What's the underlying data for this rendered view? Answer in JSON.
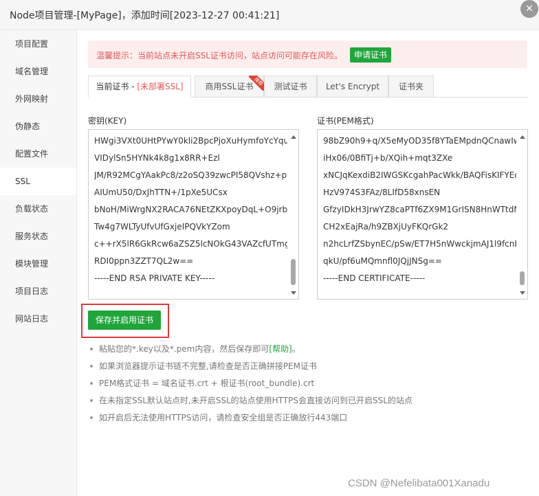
{
  "window": {
    "title": "Node项目管理-[MyPage]，添加时间[2023-12-27 00:41:21]",
    "close_glyph": "✕"
  },
  "sidebar": {
    "items": [
      {
        "label": "项目配置"
      },
      {
        "label": "域名管理"
      },
      {
        "label": "外网映射"
      },
      {
        "label": "伪静态"
      },
      {
        "label": "配置文件"
      },
      {
        "label": "SSL"
      },
      {
        "label": "负载状态"
      },
      {
        "label": "服务状态"
      },
      {
        "label": "模块管理"
      },
      {
        "label": "项目日志"
      },
      {
        "label": "网站日志"
      }
    ],
    "active_index": 5
  },
  "warning": {
    "text": "温馨提示：当前站点未开启SSL证书访问，站点访问可能存在风险。",
    "apply_button": "申请证书"
  },
  "tabs": {
    "current_prefix": "当前证书 - ",
    "current_status": "[未部署SSL]",
    "commercial": "商用SSL证书",
    "commercial_badge": "推荐",
    "test": "测试证书",
    "letsencrypt": "Let's Encrypt",
    "folder": "证书夹"
  },
  "key": {
    "label": "密钥(KEY)",
    "lines": [
      "HWgi3VXt0UHtPYwY0kli2BpcPjoXuHymfoYcYqu",
      "VIDylSn5HYNk4k8g1x8RR+Ezl",
      "JM/R92MCgYAakPc8/z2oSQ39zwcPI58QVshz+p",
      "AIUmU50/DxJhTTN+/1pXe5UCsx",
      "bNoH/MiWrgNX2RACA76NEtZKXpoyDqL+O9jrb",
      "Tw4g7WLTyUfvUfGxjeIPQVkYZom",
      "c++rX5lR6GkRcw6aZSZ5lcNOkG43VAZcfUTmg/",
      "RDI0ppn3ZZT7QL2w==",
      "-----END RSA PRIVATE KEY-----"
    ]
  },
  "cert": {
    "label": "证书(PEM格式)",
    "lines": [
      "98bZ90h9+q/X5eMyOD35f8YTaEMpdnQCnawIw",
      "iHx06/0BfiTj+b/XQih+mqt3ZXe",
      "xNCJqKexdiB2IWGSKcgahPacWkk/BAQFisKIFYEq",
      "HzV974S3FAz/8LIfD58xnsEN",
      "GfzyIDkH3JrwYZ8caPTf6ZX9M1GrISN8HnWTtdN",
      "CH2xEajRa/h9ZBXjUyFKQrGk2",
      "n2hcLrfZSbynEC/pSw/ET7H5nWwckjmAJ1l9fcnb",
      "qkU/pf6uMQmnfl0JQjJNSg==",
      "-----END CERTIFICATE-----"
    ]
  },
  "save_button": "保存并启用证书",
  "tips": {
    "tip1_prefix": "粘贴您的*.key以及*.pem内容，然后保存即可",
    "tip1_link": "[帮助]",
    "tip1_suffix": "。",
    "tip2": "如果浏览器提示证书链不完整,请检查是否正确拼接PEM证书",
    "tip3": "PEM格式证书 = 域名证书.crt + 根证书(root_bundle).crt",
    "tip4": "在未指定SSL默认站点时,未开启SSL的站点使用HTTPS会直接访问到已开启SSL的站点",
    "tip5": "如开启后无法使用HTTPS访问，请检查安全组是否正确放行443端口"
  },
  "watermark": "CSDN @Nefelibata001Xanadu",
  "colors": {
    "accent_green": "#20a53a",
    "warning_red": "#e25a5a",
    "highlight_red": "#e0383a"
  }
}
